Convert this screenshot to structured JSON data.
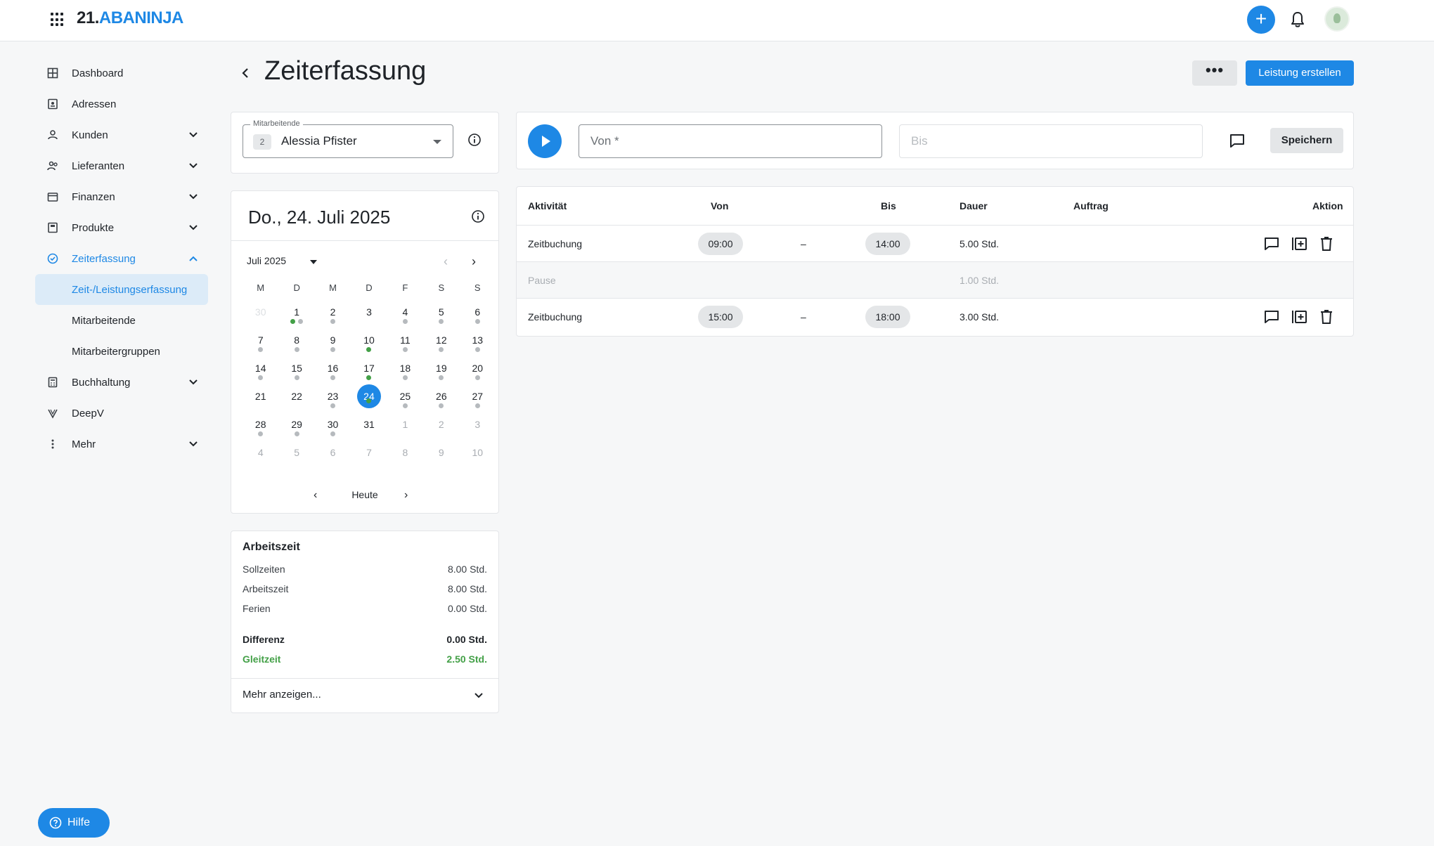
{
  "brand": {
    "number": "21.",
    "name": "ABANINJA"
  },
  "sidebar": {
    "items": [
      {
        "label": "Dashboard",
        "icon": "dashboard-icon"
      },
      {
        "label": "Adressen",
        "icon": "address-book-icon"
      },
      {
        "label": "Kunden",
        "icon": "customers-icon"
      },
      {
        "label": "Lieferanten",
        "icon": "suppliers-icon"
      },
      {
        "label": "Finanzen",
        "icon": "wallet-icon"
      },
      {
        "label": "Produkte",
        "icon": "products-icon"
      },
      {
        "label": "Zeiterfassung",
        "icon": "clock-icon"
      },
      {
        "label": "Zeit-/Leistungserfassung"
      },
      {
        "label": "Mitarbeitende"
      },
      {
        "label": "Mitarbeitergruppen"
      },
      {
        "label": "Buchhaltung",
        "icon": "calculator-icon"
      },
      {
        "label": "DeepV",
        "icon": "deepv-icon"
      },
      {
        "label": "Mehr",
        "icon": "more-vertical-icon"
      }
    ]
  },
  "page": {
    "title": "Zeiterfassung",
    "more_label": "•••",
    "primary_label": "Leistung erstellen"
  },
  "employee": {
    "legend": "Mitarbeitende",
    "badge": "2",
    "name": "Alessia Pfister"
  },
  "calendar": {
    "selected_date": "Do., 24. Juli 2025",
    "month": "Juli 2025",
    "weekdays": [
      "M",
      "D",
      "M",
      "D",
      "F",
      "S",
      "S"
    ],
    "today_label": "Heute",
    "weeks": [
      [
        "30",
        "1",
        "2",
        "3",
        "4",
        "5",
        "6"
      ],
      [
        "7",
        "8",
        "9",
        "10",
        "11",
        "12",
        "13"
      ],
      [
        "14",
        "15",
        "16",
        "17",
        "18",
        "19",
        "20"
      ],
      [
        "21",
        "22",
        "23",
        "24",
        "25",
        "26",
        "27"
      ],
      [
        "28",
        "29",
        "30",
        "31",
        "1",
        "2",
        "3"
      ],
      [
        "4",
        "5",
        "6",
        "7",
        "8",
        "9",
        "10"
      ]
    ]
  },
  "worktime": {
    "title": "Arbeitszeit",
    "rows": [
      {
        "label": "Sollzeiten",
        "value": "8.00 Std."
      },
      {
        "label": "Arbeitszeit",
        "value": "8.00 Std."
      },
      {
        "label": "Ferien",
        "value": "0.00 Std."
      }
    ],
    "diff_label": "Differenz",
    "diff_value": "0.00 Std.",
    "flex_label": "Gleitzeit",
    "flex_value": "2.50 Std.",
    "more_label": "Mehr anzeigen..."
  },
  "timer": {
    "von_placeholder": "Von *",
    "bis_placeholder": "Bis",
    "save_label": "Speichern"
  },
  "table": {
    "headers": {
      "activity": "Aktivität",
      "von": "Von",
      "bis": "Bis",
      "dauer": "Dauer",
      "auftrag": "Auftrag",
      "aktion": "Aktion"
    },
    "rows": [
      {
        "activity": "Zeitbuchung",
        "von": "09:00",
        "dash": "–",
        "bis": "14:00",
        "dauer": "5.00 Std."
      },
      {
        "activity": "Pause",
        "dauer": "1.00 Std."
      },
      {
        "activity": "Zeitbuchung",
        "von": "15:00",
        "dash": "–",
        "bis": "18:00",
        "dauer": "3.00 Std."
      }
    ]
  },
  "help": {
    "label": "Hilfe"
  },
  "colors": {
    "accent": "#1e88e5",
    "success": "#43a047",
    "selected_bg": "#dcebf8"
  }
}
